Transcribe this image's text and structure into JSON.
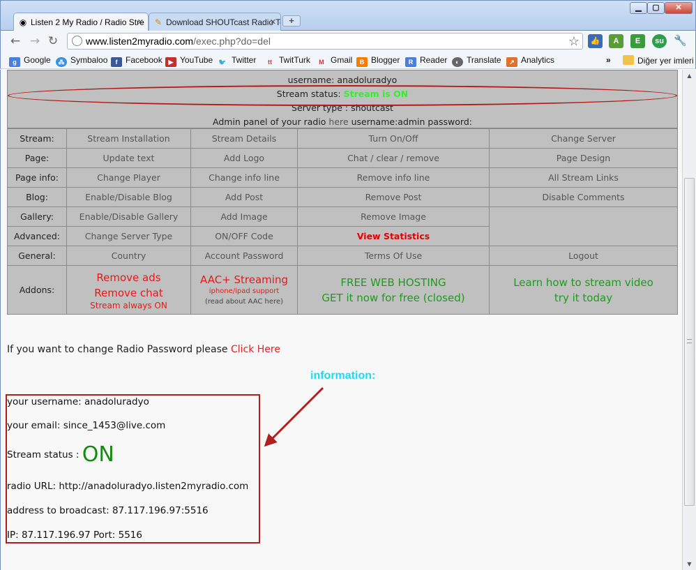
{
  "browser": {
    "tabs": [
      {
        "label": "Listen 2 My Radio / Radio Stre",
        "active": true
      },
      {
        "label": "Download SHOUTcast Radio Tc",
        "active": false
      }
    ],
    "url_host": "www.listen2myradio.com",
    "url_path": "/exec.php?do=del",
    "bookmarks": [
      {
        "label": "Google",
        "icon": "google-icon"
      },
      {
        "label": "Symbaloo",
        "icon": "symbaloo-icon"
      },
      {
        "label": "Facebook",
        "icon": "facebook-icon"
      },
      {
        "label": "YouTube",
        "icon": "youtube-icon"
      },
      {
        "label": "Twitter",
        "icon": "twitter-icon"
      },
      {
        "label": "TwitTurk",
        "icon": "twitturk-icon"
      },
      {
        "label": "Gmail",
        "icon": "gmail-icon"
      },
      {
        "label": "Blogger",
        "icon": "blogger-icon"
      },
      {
        "label": "Reader",
        "icon": "reader-icon"
      },
      {
        "label": "Translate",
        "icon": "translate-icon"
      },
      {
        "label": "Analytics",
        "icon": "analytics-icon"
      }
    ],
    "overflow_label": "»",
    "other_bookmarks": "Diğer yer imleri"
  },
  "status_panel": {
    "username_line": "username: anadoluradyo",
    "stream_status_label": "Stream status:",
    "stream_status_value": "Stream is ON",
    "server_type_line": "Server type : shoutcast",
    "admin_prefix": "Admin panel of your radio",
    "admin_link": "here",
    "admin_suffix": "username:admin password:"
  },
  "menu": {
    "stream": {
      "label": "Stream:",
      "items": [
        "Stream Installation",
        "Stream Details",
        "Turn On/Off",
        "Change Server"
      ]
    },
    "page": {
      "label": "Page:",
      "items": [
        "Update text",
        "Add Logo",
        "Chat / clear / remove",
        "Page Design"
      ]
    },
    "page_info": {
      "label": "Page info:",
      "items": [
        "Change Player",
        "Change info line",
        "Remove info line",
        "All Stream Links"
      ]
    },
    "blog": {
      "label": "Blog:",
      "items": [
        "Enable/Disable Blog",
        "Add Post",
        "Remove Post",
        "Disable Comments"
      ]
    },
    "gallery": {
      "label": "Gallery:",
      "items": [
        "Enable/Disable Gallery",
        "Add Image",
        "Remove Image"
      ]
    },
    "advanced": {
      "label": "Advanced:",
      "items": [
        "Change Server Type",
        "ON/OFF Code",
        "View Statistics"
      ]
    },
    "general": {
      "label": "General:",
      "items": [
        "Country",
        "Account Password",
        "Terms Of Use",
        "Logout"
      ]
    },
    "addons": {
      "label": "Addons:",
      "remove_ads": "Remove ads",
      "remove_chat": "Remove chat",
      "stream_always_on": "Stream always ON",
      "aac_streaming": "AAC+ Streaming",
      "iphone_support": "iphone/ipad support",
      "read_about_aac": "(read about AAC here)",
      "free_hosting": "FREE WEB HOSTING",
      "get_it_now": "GET it now for free (closed)",
      "learn_video": "Learn how to stream video",
      "try_it_today": "try it today"
    }
  },
  "change_password": {
    "text": "If you want to change Radio Password please",
    "link": "Click Here"
  },
  "annotation": "information:",
  "account_info": {
    "username": "your username: anadoluradyo",
    "email": "your email: since_1453@live.com",
    "stream_status_label": "Stream status :",
    "stream_status_value": "ON",
    "radio_url": "radio URL: http://anadoluradyo.listen2myradio.com",
    "broadcast": "address to broadcast: 87.117.196.97:5516",
    "ip_port": "IP: 87.117.196.97 Port: 5516"
  },
  "colors": {
    "stream_on": "#33ee33",
    "link_red": "#d22222",
    "annotation_cyan": "#22d8ee",
    "box_red": "#b01e1e",
    "addon_green": "#1e9a1e"
  }
}
